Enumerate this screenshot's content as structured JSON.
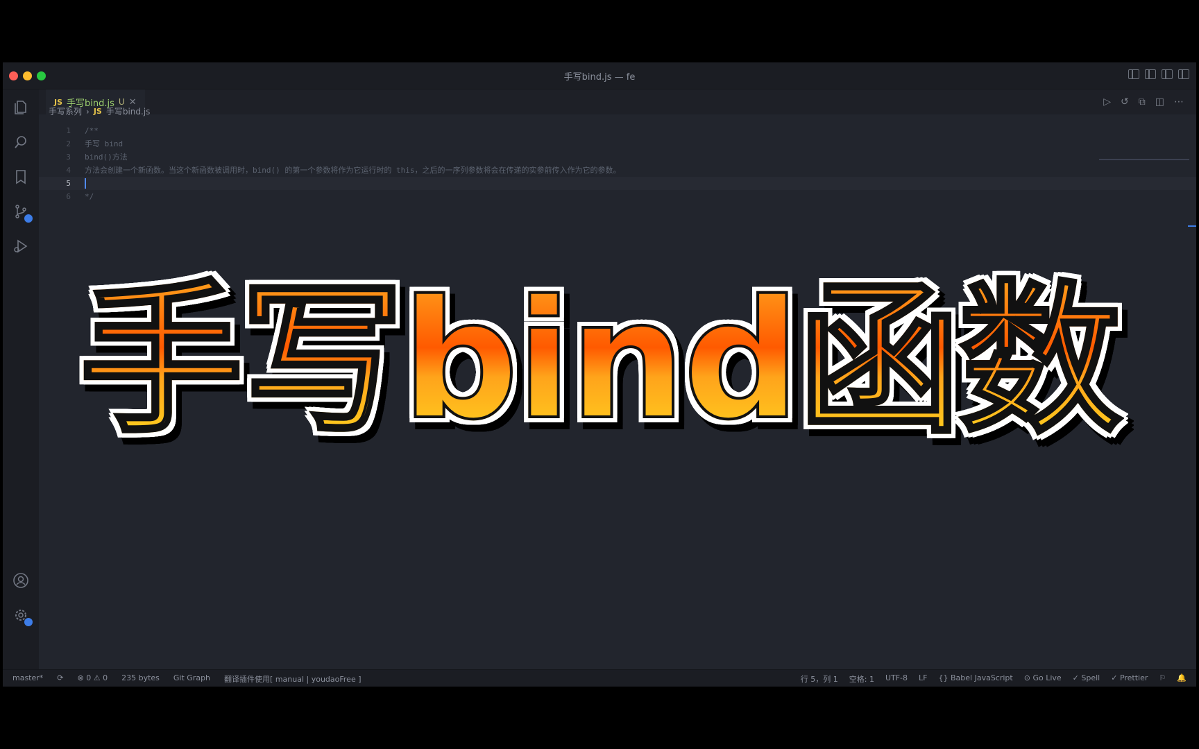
{
  "window": {
    "title": "手写bind.js — fe"
  },
  "tab": {
    "icon": "JS",
    "label": "手写bind.js",
    "status": "U"
  },
  "breadcrumb": {
    "folder": "手写系列",
    "file": "手写bind.js"
  },
  "code_lines": [
    {
      "num": "1",
      "text": "/**"
    },
    {
      "num": "2",
      "text": "手写 bind"
    },
    {
      "num": "3",
      "text": "bind()方法"
    },
    {
      "num": "4",
      "text": "方法会创建一个新函数。当这个新函数被调用时，bind() 的第一个参数将作为它运行时的 this，之后的一序列参数将会在传递的实参前传入作为它的参数。"
    },
    {
      "num": "5",
      "text": ""
    },
    {
      "num": "6",
      "text": "*/"
    }
  ],
  "status": {
    "branch": "master*",
    "errors": "⊗ 0 ⚠ 0",
    "size": "235 bytes",
    "git_graph": "Git Graph",
    "plugin": "翻译插件使用[ manual | youdaoFree ]",
    "position": "行 5，列 1",
    "spaces": "空格: 1",
    "encoding": "UTF-8",
    "eol": "LF",
    "language": "{} Babel JavaScript",
    "golive": "⊙ Go Live",
    "spell": "✓ Spell",
    "prettier": "✓ Prettier"
  },
  "overlay": {
    "title": "手写bind函数"
  },
  "colors": {
    "background": "#000000",
    "editor": "#22252d",
    "accent": "#3d7de8",
    "title_top": "#ff9f1c",
    "title_mid": "#ff5a00",
    "title_bottom": "#ffd21f"
  },
  "icons": [
    "files-icon",
    "search-icon",
    "bookmark-icon",
    "source-control-icon",
    "run-debug-icon",
    "account-icon",
    "settings-icon"
  ]
}
